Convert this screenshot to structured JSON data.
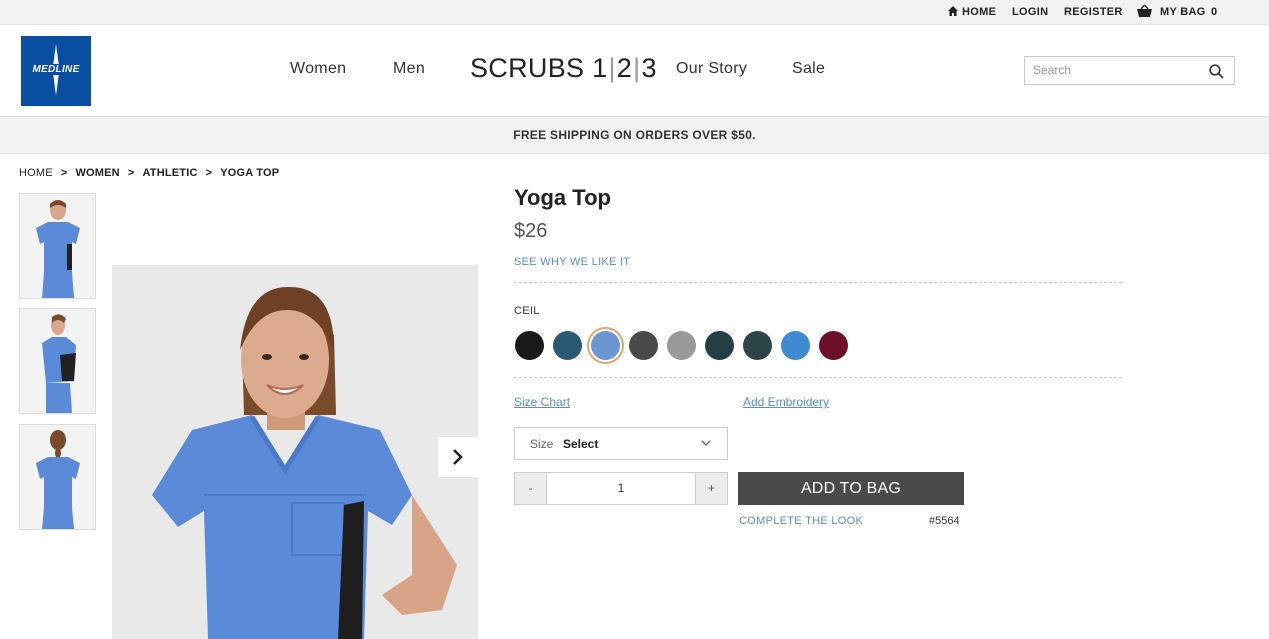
{
  "topbar": {
    "home": "HOME",
    "login": "LOGIN",
    "register": "REGISTER",
    "bag_label": "MY BAG",
    "bag_count": "0"
  },
  "header": {
    "logo_text": "MEDLINE",
    "nav": [
      "Women",
      "Men",
      "Our Story",
      "Sale"
    ],
    "brand": {
      "word": "SCRUBS",
      "d1": "1",
      "d2": "2",
      "d3": "3"
    },
    "search_placeholder": "Search"
  },
  "banner": {
    "text": "FREE SHIPPING ON ORDERS OVER $50."
  },
  "breadcrumb": [
    "HOME",
    "WOMEN",
    "ATHLETIC",
    "YOGA TOP"
  ],
  "product": {
    "title": "Yoga Top",
    "price": "$26",
    "why_link": "SEE WHY WE LIKE IT",
    "color_name": "CEIL",
    "swatches": [
      "#1a1a1a",
      "#2a5a73",
      "#6d95d1",
      "#4a4a4a",
      "#9a9a9a",
      "#233f45",
      "#2c4448",
      "#3f8ad0",
      "#6b0f2a"
    ],
    "selected_swatch": 2,
    "size_chart": "Size Chart",
    "add_embroidery": "Add Embroidery",
    "size_label": "Size",
    "size_value": "Select",
    "qty_minus": "-",
    "qty_value": "1",
    "qty_plus": "+",
    "add_to_bag": "ADD TO BAG",
    "complete_look": "COMPLETE THE LOOK",
    "style_number": "#5564"
  },
  "colors": {
    "brand_blue": "#0a4ea1",
    "link_blue": "#5a8fc8",
    "scrub_blue": "#5b8ad9",
    "selected_ring": "#e8a36b"
  }
}
